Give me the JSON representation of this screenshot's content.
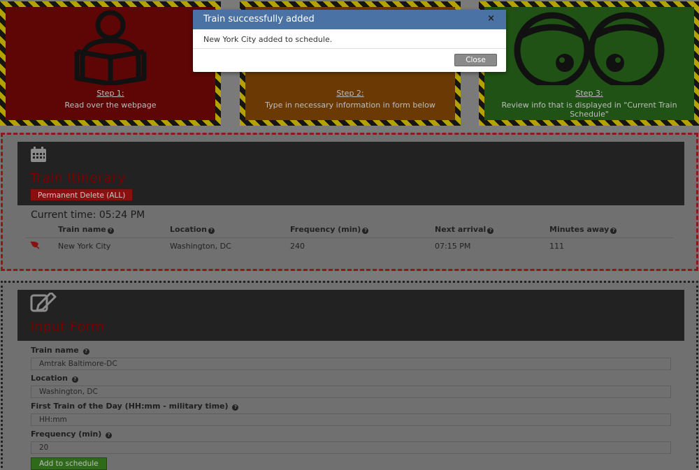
{
  "steps": [
    {
      "step_label": "Step 1:",
      "text": "Read over the webpage",
      "icon": "reading-person-icon"
    },
    {
      "step_label": "Step 2:",
      "text": "Type in necessary information in form below",
      "icon": "form-icon"
    },
    {
      "step_label": "Step 3:",
      "text": "Review info that is displayed in \"Current Train Schedule\"",
      "icon": "eyes-icon"
    }
  ],
  "itinerary": {
    "title": "Train Itinerary",
    "delete_button": "Permanent Delete (ALL)",
    "current_time_label": "Current time: 05:24 PM",
    "columns": [
      "Train name",
      "Location",
      "Frequency (min)",
      "Next arrival",
      "Minutes away"
    ],
    "rows": [
      {
        "name": "New York City",
        "location": "Washington, DC",
        "frequency": "240",
        "next_arrival": "07:15 PM",
        "minutes_away": "111"
      }
    ]
  },
  "form": {
    "title": "Input Form",
    "fields": [
      {
        "label": "Train name",
        "value": "Amtrak Baltimore-DC"
      },
      {
        "label": "Location",
        "value": "Washington, DC"
      },
      {
        "label": "First Train of the Day (HH:mm - military time)",
        "value": "HH:mm"
      },
      {
        "label": "Frequency (min)",
        "value": "20"
      }
    ],
    "submit_label": "Add to schedule"
  },
  "modal": {
    "title": "Train successfully added",
    "close_x": "×",
    "message": "New York City added to schedule.",
    "close_button": "Close"
  },
  "colors": {
    "overlay_bg": "#7a7a7a",
    "step1_bg": "#5e0606",
    "step2_bg": "#6b3a04",
    "step3_bg": "#1f5214",
    "modal_header": "#4a72a4",
    "delete_button": "#8a0f0f",
    "submit_button": "#2f6a1a"
  }
}
